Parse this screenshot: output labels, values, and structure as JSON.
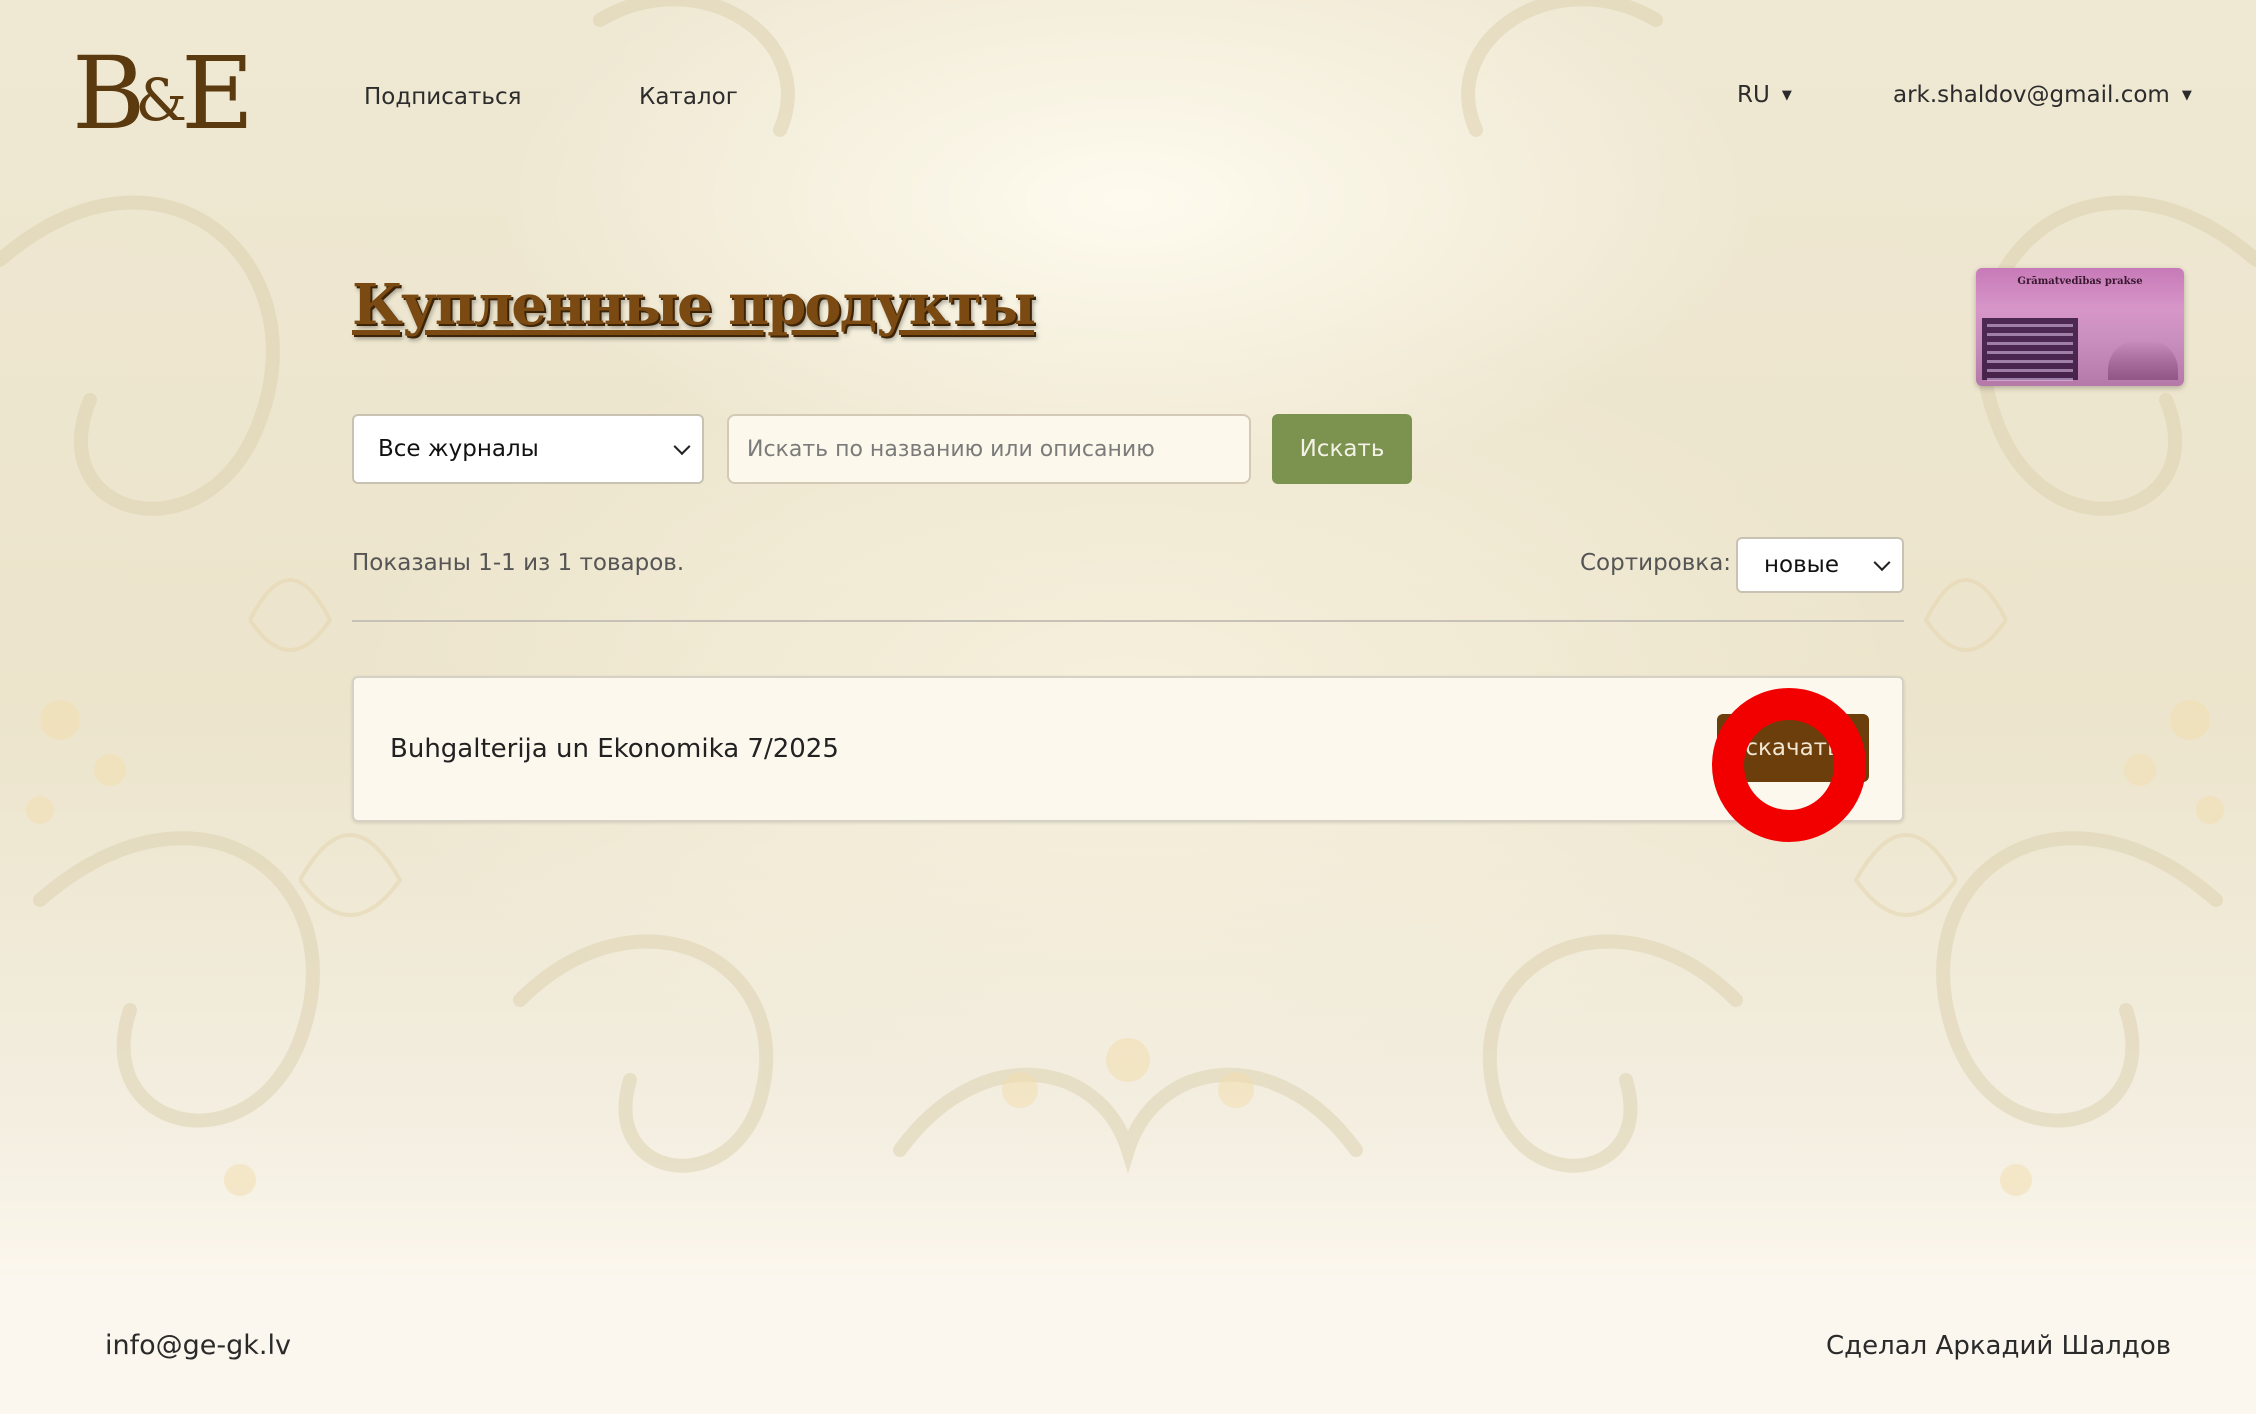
{
  "header": {
    "logo": {
      "letter_b": "B",
      "ampersand": "&",
      "letter_e": "E"
    },
    "nav": {
      "subscribe": "Подписаться",
      "catalog": "Каталог"
    },
    "language": "RU",
    "user_email": "ark.shaldov@gmail.com"
  },
  "thumbnail": {
    "title": "Grāmatvedības prakse"
  },
  "page": {
    "title": "Купленные продукты"
  },
  "filters": {
    "journal_select": "Все журналы",
    "search_placeholder": "Искать по названию или описанию",
    "search_value": "",
    "search_button": "Искать"
  },
  "results": {
    "count_text": "Показаны 1-1 из 1 товаров.",
    "sort_label": "Сортировка:",
    "sort_value": "новые"
  },
  "products": [
    {
      "title": "Buhgalterija un Ekonomika 7/2025",
      "action": "скачать"
    }
  ],
  "footer": {
    "email": "info@ge-gk.lv",
    "credit": "Сделал Аркадий Шалдов"
  },
  "colors": {
    "brand_brown": "#6b3e0c",
    "search_green": "#7c9350",
    "marker_red": "#f20000"
  }
}
